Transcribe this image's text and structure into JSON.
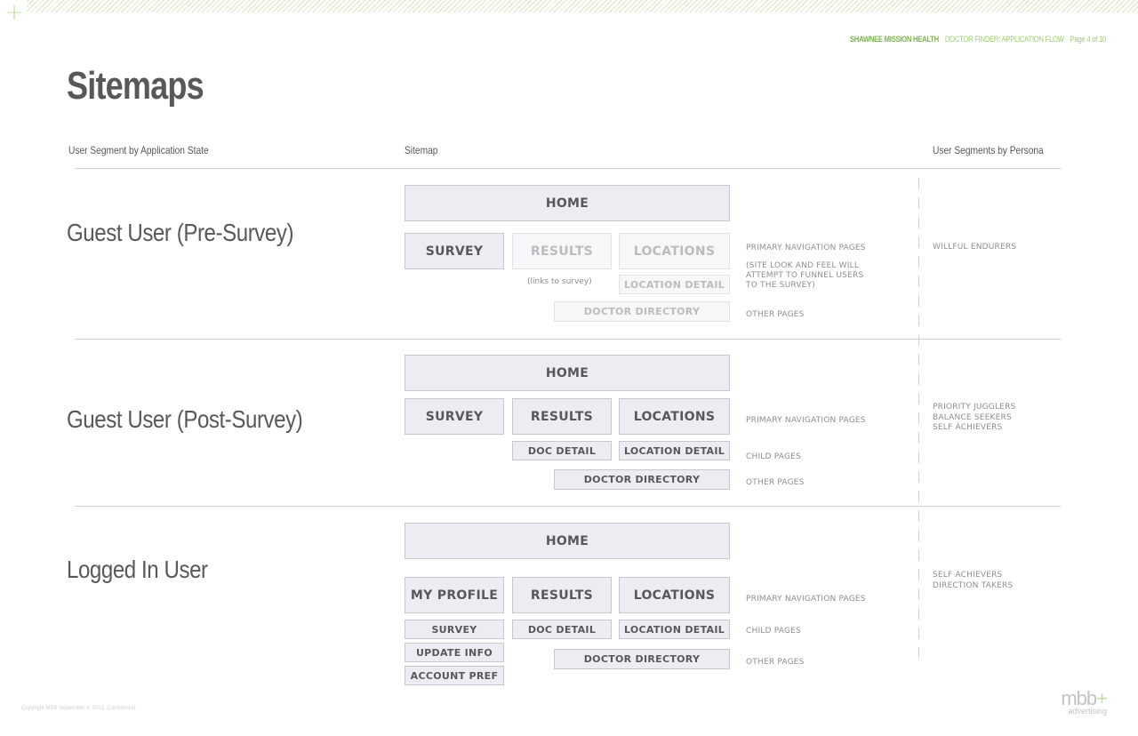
{
  "header": {
    "brand": "SHAWNEE MISSION HEALTH",
    "doc": "DOCTOR FINDER: APPLICATION FLOW",
    "page": "Page 4 of 10"
  },
  "title": "Sitemaps",
  "columns": {
    "left": "User Segment by Application State",
    "middle": "Sitemap",
    "right": "User Segments by Persona"
  },
  "sections": [
    {
      "title": "Guest User (Pre-Survey)",
      "home": "HOME",
      "nav": [
        "SURVEY",
        "RESULTS",
        "LOCATIONS"
      ],
      "results_note": "(links to survey)",
      "child": [
        "LOCATION DETAIL"
      ],
      "directory": "DOCTOR DIRECTORY",
      "labels": {
        "primary": "PRIMARY NAVIGATION PAGES",
        "note_lines": [
          "(SITE LOOK AND FEEL WILL",
          "ATTEMPT TO FUNNEL USERS",
          "TO THE SURVEY)"
        ],
        "other": "OTHER PAGES"
      },
      "personas": [
        "WILLFUL ENDURERS"
      ]
    },
    {
      "title": "Guest User (Post-Survey)",
      "home": "HOME",
      "nav": [
        "SURVEY",
        "RESULTS",
        "LOCATIONS"
      ],
      "child": [
        "DOC DETAIL",
        "LOCATION DETAIL"
      ],
      "directory": "DOCTOR DIRECTORY",
      "labels": {
        "primary": "PRIMARY NAVIGATION PAGES",
        "child": "CHILD PAGES",
        "other": "OTHER PAGES"
      },
      "personas": [
        "PRIORITY JUGGLERS",
        "BALANCE SEEKERS",
        "SELF ACHIEVERS"
      ]
    },
    {
      "title": "Logged In User",
      "home": "HOME",
      "nav": [
        "MY PROFILE",
        "RESULTS",
        "LOCATIONS"
      ],
      "profile_children": [
        "SURVEY",
        "UPDATE INFO",
        "ACCOUNT PREF"
      ],
      "child": [
        "DOC DETAIL",
        "LOCATION DETAIL"
      ],
      "directory": "DOCTOR DIRECTORY",
      "labels": {
        "primary": "PRIMARY NAVIGATION PAGES",
        "child": "CHILD PAGES",
        "other": "OTHER PAGES"
      },
      "personas": [
        "SELF ACHIEVERS",
        "DIRECTION TAKERS"
      ]
    }
  ],
  "footer": {
    "copyright": "Copyright MBB September 4, 2015. Confidential.",
    "logo_main": "mbb",
    "logo_plus": "+",
    "logo_sub": "advertising"
  }
}
